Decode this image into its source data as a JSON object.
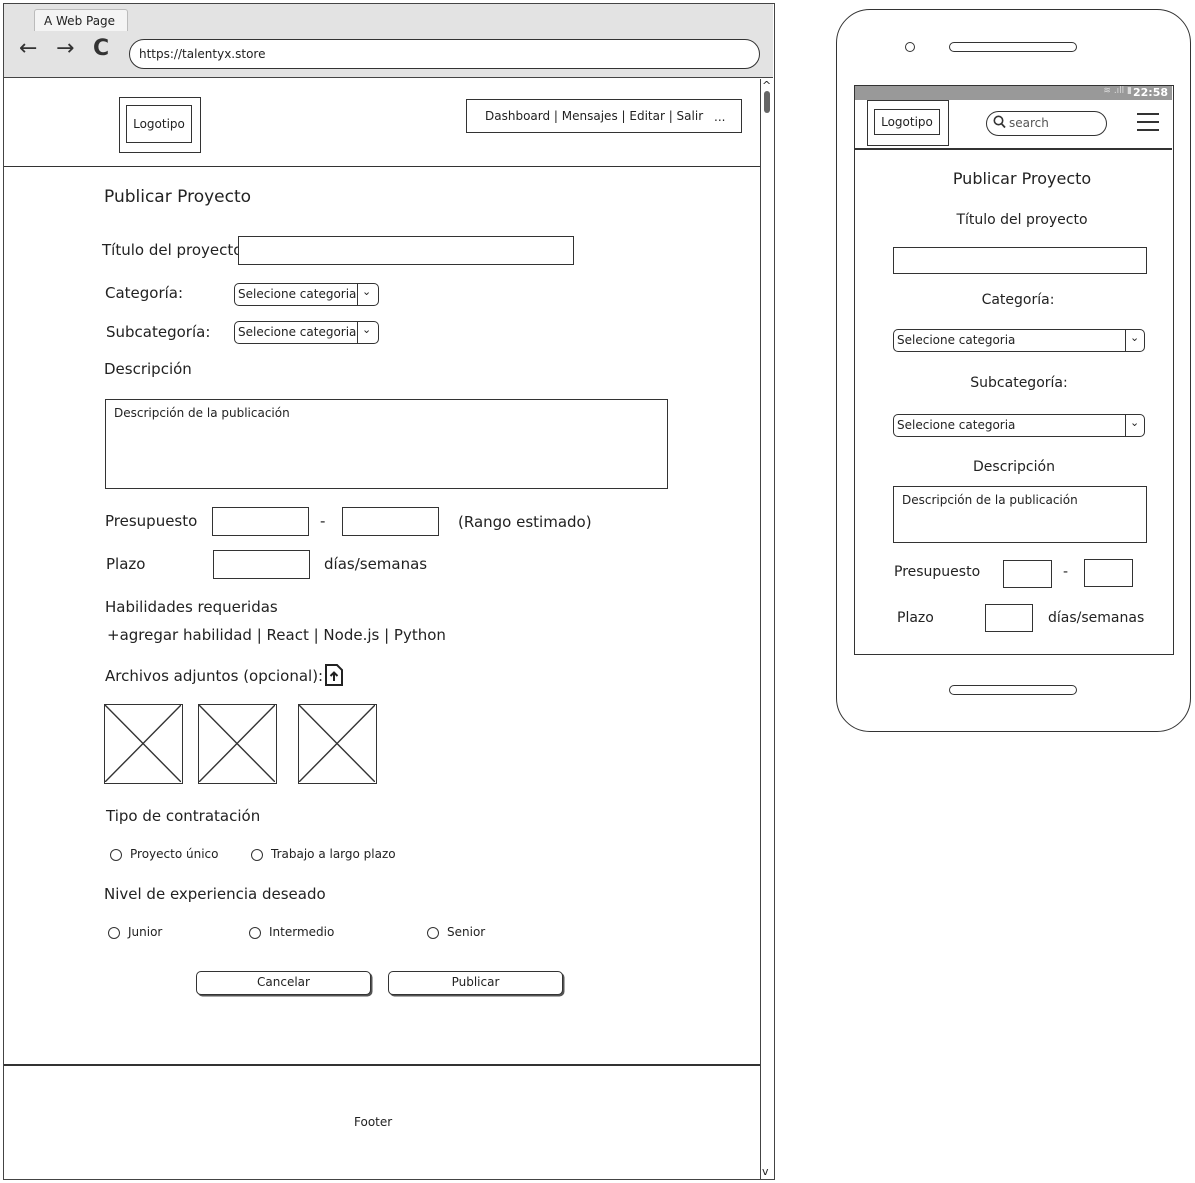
{
  "browser": {
    "tab_title": "A Web Page",
    "url": "https://talentyx.store",
    "back_icon": "←",
    "forward_icon": "→",
    "reload_icon": "C"
  },
  "desktop": {
    "logo": "Logotipo",
    "nav_text": "Dashboard | Mensajes | Editar | Salir",
    "nav_more": "...",
    "page_title": "Publicar Proyecto",
    "title_label": "Título del proyecto",
    "category_label": "Categoría:",
    "subcategory_label": "Subcategoría:",
    "category_value": "Selecione categoria",
    "subcategory_value": "Selecione categoria",
    "description_label": "Descripción",
    "description_placeholder": "Descripción de la publicación",
    "budget_label": "Presupuesto",
    "budget_dash": "-",
    "budget_hint": "(Rango estimado)",
    "deadline_label": "Plazo",
    "deadline_unit": "días/semanas",
    "skills_label": "Habilidades requeridas",
    "skills_line": "+agregar habilidad | React | Node.js | Python",
    "attachments_label": "Archivos adjuntos (opcional):",
    "hire_type_label": "Tipo de contratación",
    "hire_options": [
      "Proyecto único",
      "Trabajo a largo plazo"
    ],
    "experience_label": "Nivel de experiencia deseado",
    "experience_options": [
      "Junior",
      "Intermedio",
      "Senior"
    ],
    "cancel_button": "Cancelar",
    "publish_button": "Publicar",
    "footer": "Footer"
  },
  "mobile": {
    "status_time": "22:58",
    "logo": "Logotipo",
    "search_placeholder": "search",
    "page_title": "Publicar Proyecto",
    "title_label": "Título del proyecto",
    "category_label": "Categoría:",
    "category_value": "Selecione categoria",
    "subcategory_label": "Subcategoría:",
    "subcategory_value": "Selecione categoria",
    "description_label": "Descripción",
    "description_placeholder": "Descripción de la publicación",
    "budget_label": "Presupuesto",
    "budget_dash": "-",
    "deadline_label": "Plazo",
    "deadline_unit": "días/semanas"
  }
}
